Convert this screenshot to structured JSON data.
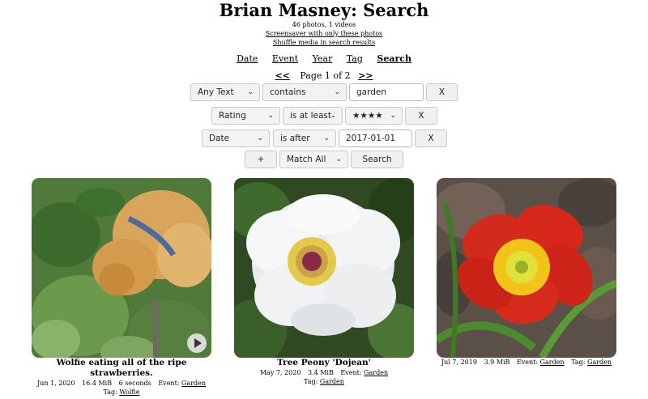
{
  "header": {
    "title": "Brian Masney: Search",
    "stats": "46 photos, 1 videos",
    "screensaver_link": "Screensaver with only these photos",
    "shuffle_link": "Shuffle media in search results"
  },
  "nav": {
    "date": "Date",
    "event": "Event",
    "year": "Year",
    "tag": "Tag",
    "search": "Search",
    "active": "Search"
  },
  "pager": {
    "prev": "<<",
    "next": ">>",
    "label": "Page 1 of 2"
  },
  "search_form": {
    "rows": [
      {
        "field": "Any Text",
        "op": "contains",
        "value": "garden",
        "remove": "X"
      },
      {
        "field": "Rating",
        "op": "is at least",
        "value": "★★★★",
        "remove": "X"
      },
      {
        "field": "Date",
        "op": "is after",
        "value": "2017-01-01",
        "remove": "X"
      }
    ],
    "add_label": "+",
    "match_label": "Match All",
    "search_label": "Search"
  },
  "results": [
    {
      "title": "Wolfie eating all of the ripe strawberries.",
      "date": "Jun 1, 2020",
      "size": "16.4 MiB",
      "duration": "6 seconds",
      "event_label": "Event:",
      "event": "Garden",
      "tag_label": "Tag:",
      "tag": "Wolfie",
      "is_video": true
    },
    {
      "title": "Tree Peony 'Dojean'",
      "date": "May 7, 2020",
      "size": "3.4 MiB",
      "event_label": "Event:",
      "event": "Garden",
      "tag_label": "Tag:",
      "tag": "Garden"
    },
    {
      "title": "",
      "date": "Jul 7, 2019",
      "size": "3.9 MiB",
      "event_label": "Event:",
      "event": "Garden",
      "tag_label": "Tag:",
      "tag": "Garden"
    }
  ]
}
